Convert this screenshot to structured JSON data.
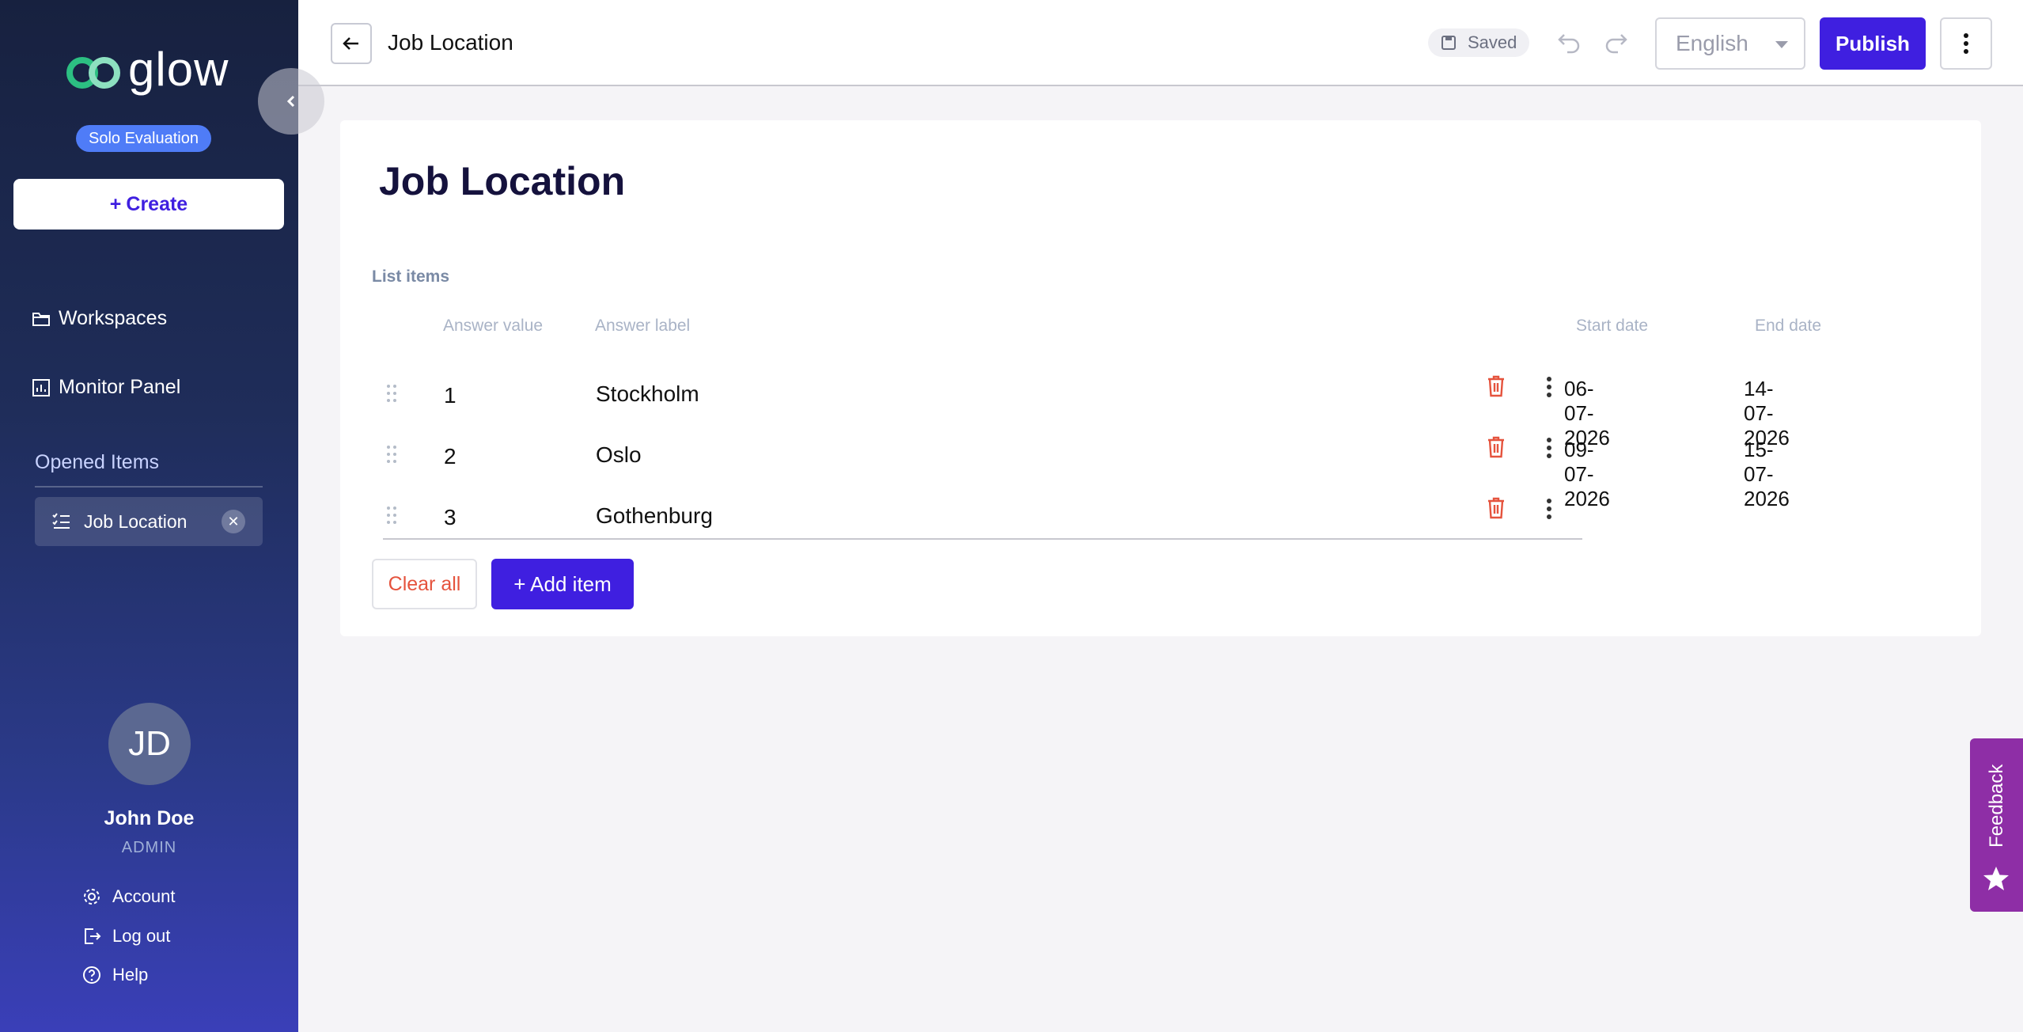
{
  "sidebar": {
    "logo_text": "glow",
    "plan_badge": "Solo Evaluation",
    "create_label": "Create",
    "nav": [
      {
        "label": "Workspaces",
        "icon": "folder-icon"
      },
      {
        "label": "Monitor Panel",
        "icon": "chart-icon"
      }
    ],
    "opened_title": "Opened Items",
    "opened_items": [
      {
        "label": "Job Location",
        "icon": "list-icon"
      }
    ],
    "user": {
      "initials": "JD",
      "name": "John Doe",
      "role": "ADMIN"
    },
    "footer": [
      {
        "label": "Account",
        "icon": "gear-icon"
      },
      {
        "label": "Log out",
        "icon": "logout-icon"
      },
      {
        "label": "Help",
        "icon": "help-icon"
      }
    ]
  },
  "topbar": {
    "title": "Job Location",
    "saved_label": "Saved",
    "language": "English",
    "publish_label": "Publish"
  },
  "main": {
    "title": "Job Location",
    "list_label": "List items",
    "columns": {
      "value": "Answer value",
      "label": "Answer label",
      "start": "Start date",
      "end": "End date"
    },
    "rows": [
      {
        "value": "1",
        "label": "Stockholm",
        "start": "06-07-2026",
        "end": "14-07-2026"
      },
      {
        "value": "2",
        "label": "Oslo",
        "start": "09-07-2026",
        "end": "15-07-2026"
      },
      {
        "value": "3",
        "label": "Gothenburg",
        "start": "",
        "end": ""
      }
    ],
    "clear_label": "Clear all",
    "add_label": "+ Add item"
  },
  "feedback_label": "Feedback",
  "colors": {
    "accent": "#3f1fe0",
    "danger": "#e5533d",
    "feedback": "#8e2ea6",
    "badge": "#4f7cf7"
  }
}
